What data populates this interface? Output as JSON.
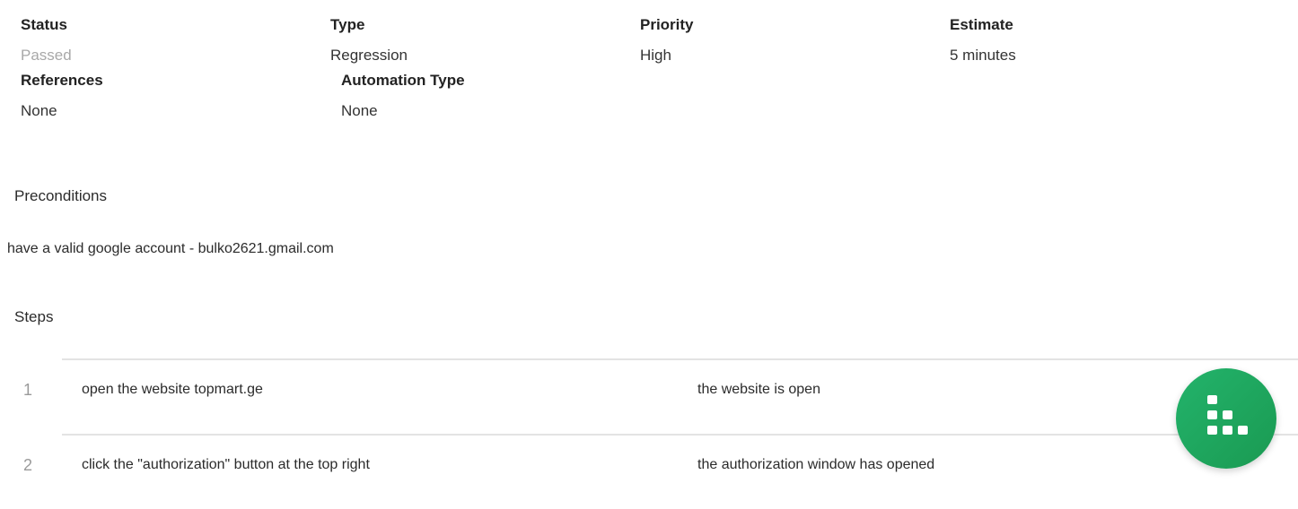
{
  "fields": {
    "row1": [
      {
        "label": "Status",
        "value": "Passed",
        "muted": true
      },
      {
        "label": "Type",
        "value": "Regression"
      },
      {
        "label": "Priority",
        "value": "High"
      },
      {
        "label": "Estimate",
        "value": "5 minutes"
      }
    ],
    "row2": [
      {
        "label": "References",
        "value": "None"
      },
      {
        "label": "Automation Type",
        "value": "None"
      }
    ]
  },
  "preconditions": {
    "title": "Preconditions",
    "text": "have a valid google account - bulko2621.gmail.com"
  },
  "steps": {
    "title": "Steps",
    "items": [
      {
        "number": "1",
        "action": "open the website topmart.ge",
        "expected": "the website is open"
      },
      {
        "number": "2",
        "action": "click the \"authorization\" button at the top right",
        "expected": "the authorization window has opened"
      }
    ]
  },
  "fab": {
    "icon": "grid-dots-icon",
    "color": "#1fa85f"
  }
}
